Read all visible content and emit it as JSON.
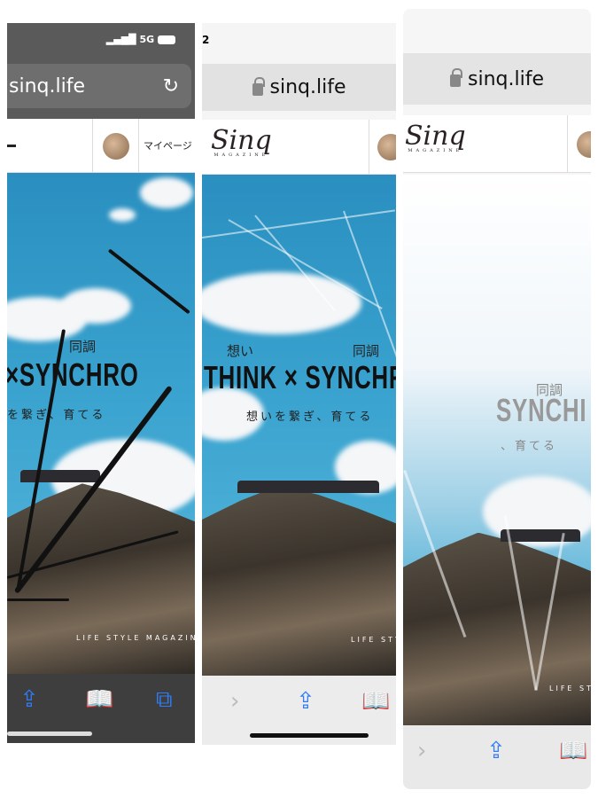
{
  "panels": [
    {
      "status": {
        "network": "5G"
      },
      "url": "sinq.life",
      "header": {
        "mypage": "マイページ"
      },
      "hero": {
        "kanji_top": "同調",
        "title": "×SYNCHRO",
        "subtitle": "を繋ぎ、育てる",
        "tagline": "LIFE STYLE MAGAZINE"
      },
      "toolbar": [
        "share-icon",
        "bookmarks-icon",
        "tabs-icon"
      ]
    },
    {
      "status": {
        "time_fragment": "2"
      },
      "url": "sinq.life",
      "header": {
        "logo": "Sinq",
        "logo_sub": "MAGAZINE"
      },
      "hero": {
        "kanji_left": "想い",
        "kanji_right": "同調",
        "title": "THINK × SYNCHR",
        "subtitle": "想いを繋ぎ、育てる",
        "tagline": "LIFE STY"
      },
      "toolbar": [
        "forward-icon",
        "share-icon",
        "bookmarks-icon"
      ]
    },
    {
      "url": "sinq.life",
      "header": {
        "logo": "Sinq",
        "logo_sub": "MAGAZINE"
      },
      "hero": {
        "kanji_top": "同調",
        "title": "SYNCHI",
        "subtitle": "、育てる",
        "tagline": "LIFE ST"
      },
      "toolbar": [
        "forward-icon",
        "share-icon",
        "bookmarks-icon"
      ]
    }
  ],
  "colors": {
    "accent": "#2f7cf6",
    "sky": "#3aa3cf"
  }
}
